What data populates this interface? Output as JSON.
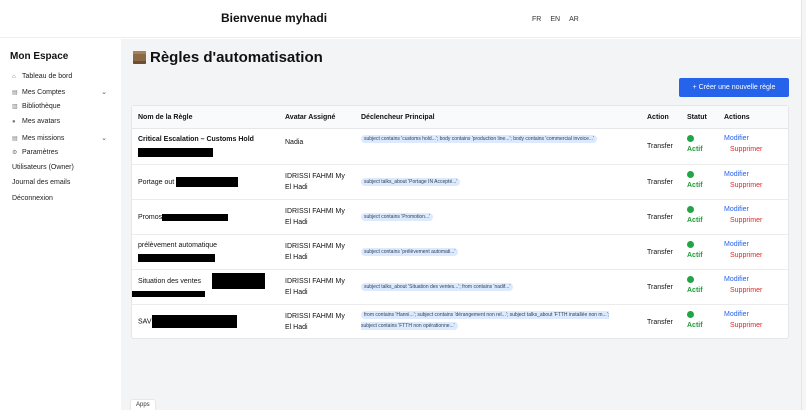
{
  "header": {
    "welcome": "Bienvenue myhadi",
    "languages": [
      "FR",
      "EN",
      "AR"
    ]
  },
  "sidebar": {
    "title": "Mon Espace",
    "items": [
      {
        "label": "Tableau de bord",
        "icon": "dashboard-icon",
        "expandable": false
      },
      {
        "label": "Mes Comptes",
        "icon": "document-icon",
        "expandable": true
      },
      {
        "label": "Bibliothèque",
        "icon": "book-icon",
        "expandable": false
      },
      {
        "label": "Mes avatars",
        "icon": "user-icon",
        "expandable": false
      },
      {
        "label": "Mes missions",
        "icon": "document-icon",
        "expandable": true
      },
      {
        "label": "Paramètres",
        "icon": "gear-icon",
        "expandable": false
      },
      {
        "label": "Utilisateurs (Owner)",
        "icon": "",
        "expandable": false
      },
      {
        "label": "Journal des emails",
        "icon": "",
        "expandable": false
      },
      {
        "label": "Déconnexion",
        "icon": "",
        "expandable": false
      }
    ]
  },
  "main": {
    "title": "Règles d'automatisation",
    "create_button": "+ Créer une nouvelle règle",
    "table": {
      "headers": [
        "Nom de la Règle",
        "Avatar Assigné",
        "Déclencheur Principal",
        "Action",
        "Statut",
        "Actions"
      ],
      "rows": [
        {
          "name": "Critical Escalation – Customs Hold",
          "avatar_l1": "Nadia",
          "avatar_l2": "",
          "triggers": [
            "subject contains 'customs hold...'",
            "body contains 'production line...'",
            "body contains 'commercial invoice...'"
          ],
          "action": "Transfer",
          "status": "Actif"
        },
        {
          "name": "Portage out",
          "avatar_l1": "IDRISSI FAHMI My",
          "avatar_l2": "El Hadi",
          "triggers": [
            "subject talks_about 'Portage IN Accepté...'"
          ],
          "action": "Transfer",
          "status": "Actif"
        },
        {
          "name": "Promos",
          "avatar_l1": "IDRISSI FAHMI My",
          "avatar_l2": "El Hadi",
          "triggers": [
            "subject contains 'Promotion...'"
          ],
          "action": "Transfer",
          "status": "Actif"
        },
        {
          "name": "prélèvement automatique",
          "avatar_l1": "IDRISSI FAHMI My",
          "avatar_l2": "El Hadi",
          "triggers": [
            "subject contains 'prélèvement automati...'"
          ],
          "action": "Transfer",
          "status": "Actif"
        },
        {
          "name": "Situation des ventes",
          "avatar_l1": "IDRISSI FAHMI My",
          "avatar_l2": "El Hadi",
          "triggers": [
            "subject talks_about 'Situation des ventes...'",
            "from contains 'nadif...'"
          ],
          "action": "Transfer",
          "status": "Actif"
        },
        {
          "name": "SAV",
          "avatar_l1": "IDRISSI FAHMI My",
          "avatar_l2": "El Hadi",
          "triggers": [
            "from contains 'Hanni...'",
            "subject contains 'dérangement non rel...'",
            "subject talks_about 'FTTH installée non m...'",
            "subject contains 'FTTH non opérationne...'"
          ],
          "action": "Transfer",
          "status": "Actif"
        }
      ],
      "modify_label": "Modifier",
      "delete_label": "Supprimer"
    }
  },
  "footer": {
    "apps_tab": "Apps"
  },
  "colors": {
    "accent": "#2563eb",
    "active": "#1f9d3a",
    "danger": "#dc2626",
    "chip": "#dbeafe"
  }
}
